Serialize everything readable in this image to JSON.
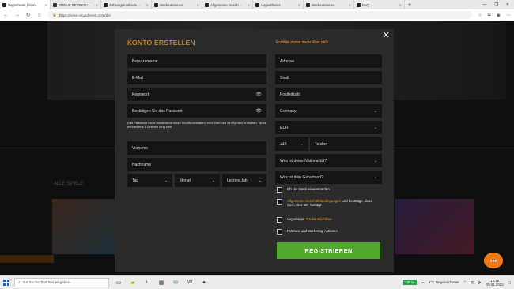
{
  "browser": {
    "tabs": [
      {
        "label": "Vegadream | Sien...",
        "active": true
      },
      {
        "label": "BONUS BEDINGU..."
      },
      {
        "label": "Zahlungsmethode..."
      },
      {
        "label": "Werbeaktionen"
      },
      {
        "label": "Allgemeine Gesch..."
      },
      {
        "label": "VegasPlatos"
      },
      {
        "label": "Werbeaktionen"
      },
      {
        "label": "FAQ"
      }
    ],
    "url": "https://www.vegadream.com/de/"
  },
  "modal": {
    "title": "KONTO ERSTELLEN",
    "subtitle": "Erzähle etwas mehr über dich",
    "left": {
      "username_placeholder": "Benutzername",
      "email_placeholder": "E-Mail",
      "password_placeholder": "Kennwort",
      "confirm_placeholder": "Bestätigen Sie das Passwort",
      "password_hint": "Das Passwort muss mindestens einen Großbuchstaben, eine Zahl und ein Symbol enthalten. Muss mindestens 8 Zeichen lang sein",
      "firstname_placeholder": "Vorname",
      "lastname_placeholder": "Nachname",
      "day_label": "Tag",
      "month_label": "Monat",
      "year_label": "Letztes Jahr"
    },
    "right": {
      "address_placeholder": "Adresse",
      "city_placeholder": "Stadt",
      "zip_placeholder": "Postleitzahl",
      "country_value": "Germany",
      "currency_value": "EUR",
      "phone_prefix": "+49",
      "phone_placeholder": "Telefon",
      "nationality_label": "Was ist deine Nationalität?",
      "birthplace_label": "Was ist dein Geburtsort?"
    },
    "checkboxes": {
      "agree": "Ich bin damit einverstanden",
      "terms_link": "Allgemeine Geschäftsbedingungen",
      "terms_rest": " und bestätige, dass mein Alter 18+ beträgt",
      "cookie_pre": "Vegadream ",
      "cookie_link": "Cookie-Richtlinie",
      "promo": "Prämien und Marketing-Aktionen"
    },
    "register_label": "REGISTRIEREN"
  },
  "background": {
    "games_label": "ALLE SPIELE"
  },
  "taskbar": {
    "search_placeholder": "Zur Suche Text hier eingeben",
    "battery": "100 %",
    "weather": "4°C  Regenschauer",
    "time": "15:18",
    "date": "09.01.2022"
  },
  "colors": {
    "accent": "#f0a020",
    "register": "#4fa82b",
    "modal_bg": "#2b2b2b",
    "field_bg": "#151515"
  }
}
